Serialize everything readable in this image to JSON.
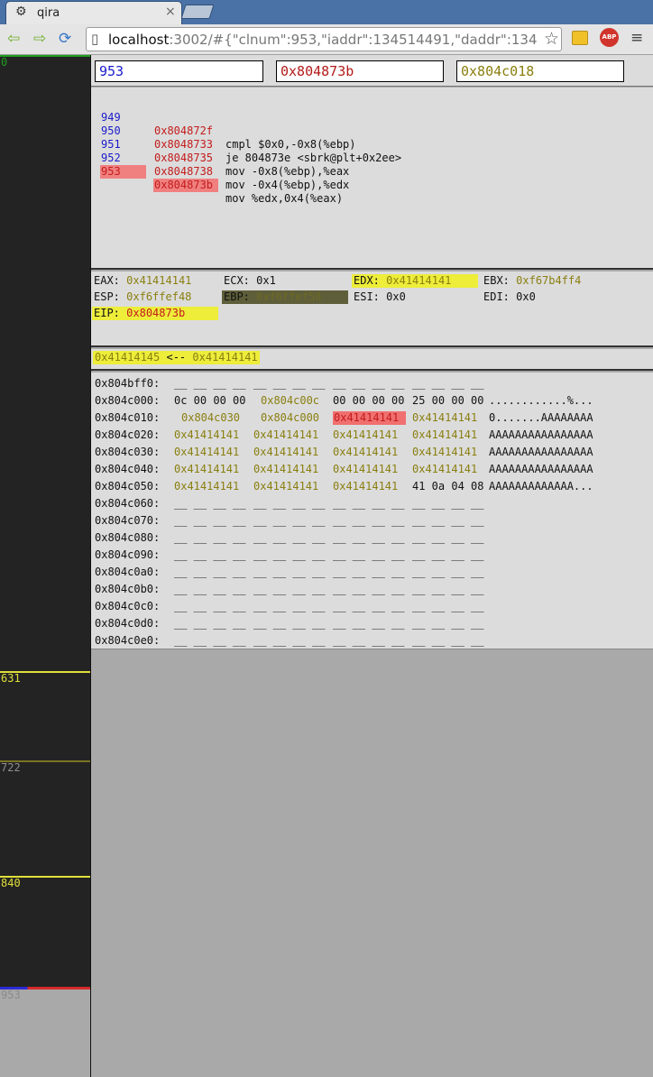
{
  "browser": {
    "tab_title": "qira",
    "url_host": "localhost",
    "url_rest": ":3002/#{\"clnum\":953,\"iaddr\":134514491,\"daddr\":134",
    "abp_label": "ABP"
  },
  "inputs": {
    "clnum": "953",
    "iaddr": "0x804873b",
    "daddr": "0x804c018"
  },
  "timeline": {
    "labels": [
      "0",
      "631",
      "722",
      "840",
      "953"
    ]
  },
  "disasm": [
    {
      "num": "949",
      "addr": "0x804872f",
      "ins": "cmpl $0x0,-0x8(%ebp)"
    },
    {
      "num": "950",
      "addr": "0x8048733",
      "ins": "je 804873e <sbrk@plt+0x2ee>"
    },
    {
      "num": "951",
      "addr": "0x8048735",
      "ins": "mov -0x8(%ebp),%eax"
    },
    {
      "num": "952",
      "addr": "0x8048738",
      "ins": "mov -0x4(%ebp),%edx"
    },
    {
      "num": "953",
      "addr": "0x804873b",
      "ins": "mov %edx,0x4(%eax)"
    }
  ],
  "registers": [
    {
      "name": "EAX:",
      "value": "0x41414141"
    },
    {
      "name": "ECX:",
      "value": "0x1"
    },
    {
      "name": "EDX:",
      "value": "0x41414141"
    },
    {
      "name": "EBX:",
      "value": "0xf67b4ff4"
    },
    {
      "name": "ESP:",
      "value": "0xf6ffef48"
    },
    {
      "name": "EBP:",
      "value": "0xf6ffef58"
    },
    {
      "name": "ESI:",
      "value": "0x0"
    },
    {
      "name": "EDI:",
      "value": "0x0"
    },
    {
      "name": "EIP:",
      "value": "0x804873b"
    }
  ],
  "memwrite": {
    "addr": "0x41414145",
    "arrow": "<--",
    "value": "0x41414141"
  },
  "hexdump": [
    {
      "addr": "0x804bff0:",
      "cells": [
        "__ __ __ __",
        "__ __ __ __",
        "__ __ __ __",
        "__ __ __ __"
      ],
      "ascii": ""
    },
    {
      "addr": "0x804c000:",
      "cells": [
        "0c 00 00 00",
        "0x804c00c",
        "00 00 00 00",
        "25 00 00 00"
      ],
      "ascii": "............%..."
    },
    {
      "addr": "0x804c010:",
      "cells": [
        "0x804c030",
        "0x804c000",
        "0x41414141",
        "0x41414141"
      ],
      "ascii": "0.......AAAAAAAA"
    },
    {
      "addr": "0x804c020:",
      "cells": [
        "0x41414141",
        "0x41414141",
        "0x41414141",
        "0x41414141"
      ],
      "ascii": "AAAAAAAAAAAAAAAA"
    },
    {
      "addr": "0x804c030:",
      "cells": [
        "0x41414141",
        "0x41414141",
        "0x41414141",
        "0x41414141"
      ],
      "ascii": "AAAAAAAAAAAAAAAA"
    },
    {
      "addr": "0x804c040:",
      "cells": [
        "0x41414141",
        "0x41414141",
        "0x41414141",
        "0x41414141"
      ],
      "ascii": "AAAAAAAAAAAAAAAA"
    },
    {
      "addr": "0x804c050:",
      "cells": [
        "0x41414141",
        "0x41414141",
        "0x41414141",
        "41 0a 04 08"
      ],
      "ascii": "AAAAAAAAAAAAA..."
    },
    {
      "addr": "0x804c060:",
      "cells": [
        "__ __ __ __",
        "__ __ __ __",
        "__ __ __ __",
        "__ __ __ __"
      ],
      "ascii": ""
    },
    {
      "addr": "0x804c070:",
      "cells": [
        "__ __ __ __",
        "__ __ __ __",
        "__ __ __ __",
        "__ __ __ __"
      ],
      "ascii": ""
    },
    {
      "addr": "0x804c080:",
      "cells": [
        "__ __ __ __",
        "__ __ __ __",
        "__ __ __ __",
        "__ __ __ __"
      ],
      "ascii": ""
    },
    {
      "addr": "0x804c090:",
      "cells": [
        "__ __ __ __",
        "__ __ __ __",
        "__ __ __ __",
        "__ __ __ __"
      ],
      "ascii": ""
    },
    {
      "addr": "0x804c0a0:",
      "cells": [
        "__ __ __ __",
        "__ __ __ __",
        "__ __ __ __",
        "__ __ __ __"
      ],
      "ascii": ""
    },
    {
      "addr": "0x804c0b0:",
      "cells": [
        "__ __ __ __",
        "__ __ __ __",
        "__ __ __ __",
        "__ __ __ __"
      ],
      "ascii": ""
    },
    {
      "addr": "0x804c0c0:",
      "cells": [
        "__ __ __ __",
        "__ __ __ __",
        "__ __ __ __",
        "__ __ __ __"
      ],
      "ascii": ""
    },
    {
      "addr": "0x804c0d0:",
      "cells": [
        "__ __ __ __",
        "__ __ __ __",
        "__ __ __ __",
        "__ __ __ __"
      ],
      "ascii": ""
    },
    {
      "addr": "0x804c0e0:",
      "cells": [
        "__ __ __ __",
        "__ __ __ __",
        "__ __ __ __",
        "__ __ __ __"
      ],
      "ascii": ""
    }
  ]
}
